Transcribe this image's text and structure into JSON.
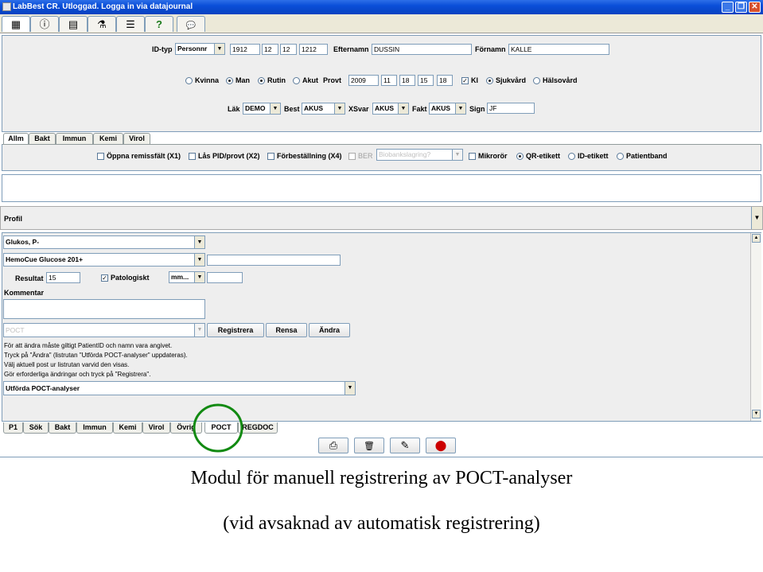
{
  "window": {
    "title": "LabBest CR. Utloggad. Logga in via datajournal",
    "minimize": "_",
    "maximize": "❐",
    "close": "✕"
  },
  "toolbar_tabs": [
    {
      "icon": "barcode-icon",
      "glyph": "▦"
    },
    {
      "icon": "info-icon",
      "glyph": "ⓘ"
    },
    {
      "icon": "book-icon",
      "glyph": "▤"
    },
    {
      "icon": "person-icon",
      "glyph": "⚗"
    },
    {
      "icon": "list-icon",
      "glyph": "☰"
    },
    {
      "icon": "help-icon",
      "glyph": "?"
    },
    {
      "icon": "speech-icon",
      "glyph": "💬"
    }
  ],
  "header": {
    "idtyp_label": "ID-typ",
    "idtyp_value": "Personnr",
    "pid": [
      "1912",
      "12",
      "12",
      "1212"
    ],
    "efternamn_label": "Efternamn",
    "efternamn_value": "DUSSIN",
    "fornamn_label": "Förnamn",
    "fornamn_value": "KALLE",
    "kvinna": "Kvinna",
    "man": "Man",
    "rutin": "Rutin",
    "akut": "Akut",
    "provt_label": "Provt",
    "provt": [
      "2009",
      "11",
      "18",
      "15",
      "18"
    ],
    "kl": "Kl",
    "sjukvard": "Sjukvård",
    "halsovard": "Hälsovård",
    "lak_label": "Läk",
    "lak_value": "DEMO",
    "best_label": "Best",
    "best_value": "AKUS",
    "xsvar_label": "XSvar",
    "xsvar_value": "AKUS",
    "fakt_label": "Fakt",
    "fakt_value": "AKUS",
    "sign_label": "Sign",
    "sign_value": "JF"
  },
  "top_tabs": [
    "Allm",
    "Bakt",
    "Immun",
    "Kemi",
    "Virol"
  ],
  "options": {
    "oppna": "Öppna remissfält (X1)",
    "las": "Lås PID/provt (X2)",
    "forbest": "Förbeställning (X4)",
    "ber": "BER",
    "biobank": "Biobankslagring?",
    "mikro": "Mikrorör",
    "qr": "QR-etikett",
    "id_etikett": "ID-etikett",
    "patientband": "Patientband"
  },
  "profil_label": "Profil",
  "poct": {
    "analys": "Glukos, P-",
    "instrument": "HemoCue Glucose 201+",
    "resultat_label": "Resultat",
    "resultat_value": "15",
    "patologiskt": "Patologiskt",
    "unit": "mm...",
    "kommentar_label": "Kommentar",
    "poct_combo": "POCT",
    "registrera": "Registrera",
    "rensa": "Rensa",
    "andra": "Ändra",
    "help": [
      "För att ändra måste giltigt PatientID och namn vara angivet.",
      "Tryck på \"Ändra\" (listrutan \"Utförda POCT-analyser\" uppdateras).",
      "Välj aktuell post ur listrutan varvid den visas.",
      "Gör erforderliga ändringar och tryck på \"Registrera\"."
    ],
    "utforda": "Utförda POCT-analyser"
  },
  "bottom_tabs": [
    "P1",
    "Sök",
    "Bakt",
    "Immun",
    "Kemi",
    "Virol",
    "Övrig",
    "POCT",
    "REGDOC"
  ],
  "action_buttons": [
    {
      "icon": "printer-icon",
      "glyph": "⎙"
    },
    {
      "icon": "trash-icon",
      "glyph": "🗑"
    },
    {
      "icon": "edit-icon",
      "glyph": "✎"
    },
    {
      "icon": "stop-icon",
      "glyph": "⬤"
    }
  ],
  "captions": [
    "Modul för manuell registrering av POCT-analyser",
    "(vid avsaknad av automatisk registrering)"
  ],
  "colors": {
    "highlight_circle": "#128a12",
    "stop": "#cc0000"
  }
}
